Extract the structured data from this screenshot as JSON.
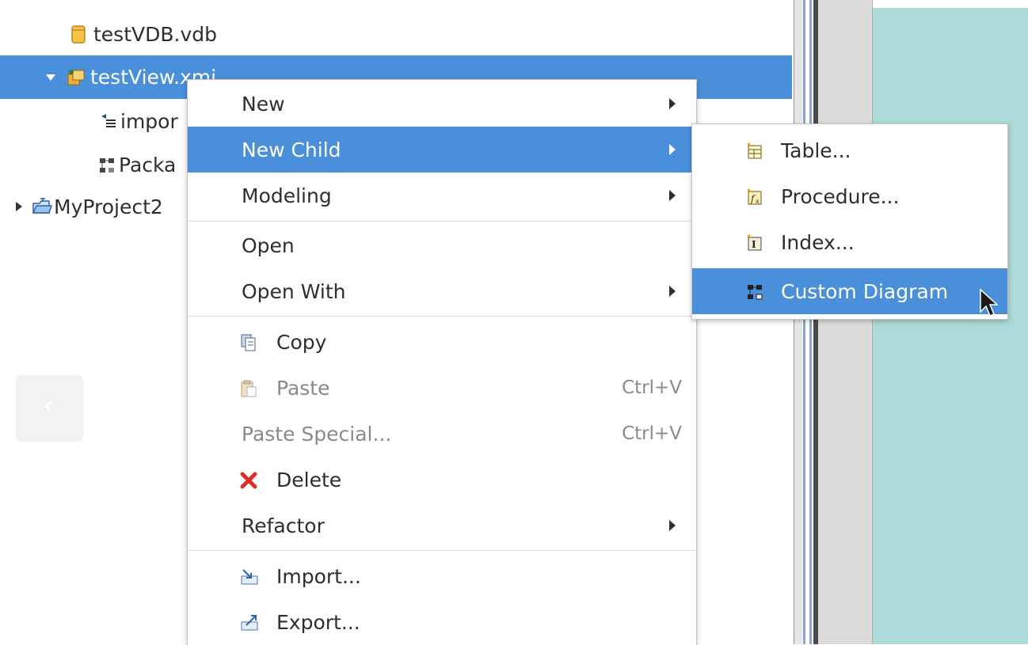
{
  "tree": {
    "items": [
      {
        "label": "testVDB.vdb",
        "icon": "vdb-icon"
      },
      {
        "label": "testView.xmi",
        "icon": "model-icon",
        "expanded": true,
        "selected": true
      },
      {
        "label": "impor",
        "icon": "import-icon"
      },
      {
        "label": "Packa",
        "icon": "package-diagram-icon"
      },
      {
        "label": "MyProject2",
        "icon": "project-folder-icon",
        "expanded": false
      }
    ]
  },
  "nav": {
    "back_glyph": "‹"
  },
  "context_menu": {
    "items": [
      {
        "label": "New",
        "has_submenu": true
      },
      {
        "label": "New Child",
        "has_submenu": true,
        "highlighted": true
      },
      {
        "label": "Modeling",
        "has_submenu": true
      },
      {
        "label": "Open"
      },
      {
        "label": "Open With",
        "has_submenu": true
      },
      {
        "label": "Copy",
        "icon": "copy-icon"
      },
      {
        "label": "Paste",
        "icon": "paste-icon",
        "shortcut": "Ctrl+V",
        "disabled": true
      },
      {
        "label": "Paste Special...",
        "shortcut": "Ctrl+V",
        "disabled": true
      },
      {
        "label": "Delete",
        "icon": "delete-icon"
      },
      {
        "label": "Refactor",
        "has_submenu": true
      },
      {
        "label": "Import...",
        "icon": "import-wizard-icon"
      },
      {
        "label": "Export...",
        "icon": "export-wizard-icon"
      }
    ]
  },
  "submenu": {
    "items": [
      {
        "label": "Table...",
        "icon": "table-icon"
      },
      {
        "label": "Procedure...",
        "icon": "procedure-icon"
      },
      {
        "label": "Index...",
        "icon": "index-icon"
      },
      {
        "label": "Custom Diagram",
        "icon": "custom-diagram-icon",
        "highlighted": true
      }
    ]
  },
  "colors": {
    "selection": "#4a8fd9",
    "right_panel": "#acdad8",
    "sash": "#dcdcdc",
    "delete_red": "#d9302c"
  }
}
